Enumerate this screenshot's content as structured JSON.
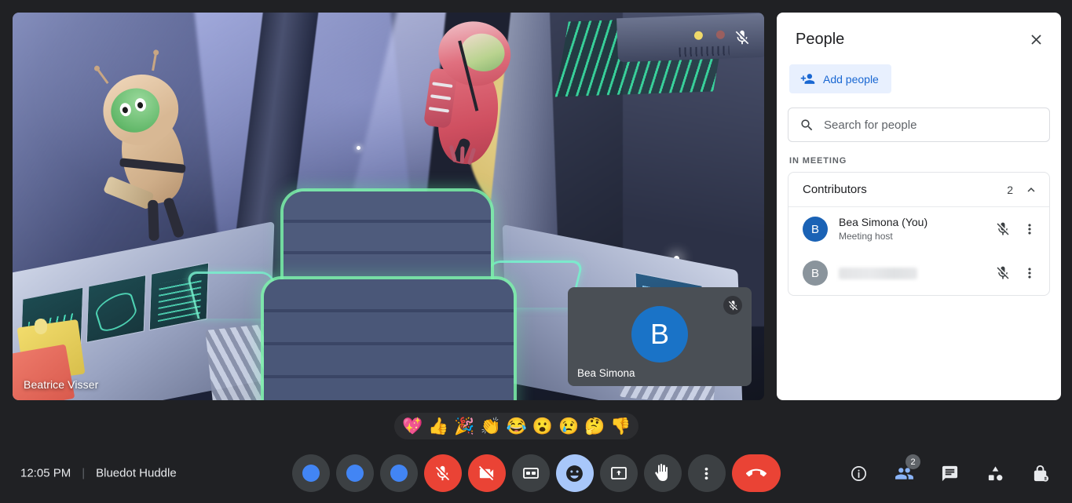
{
  "meeting": {
    "time": "12:05 PM",
    "separator": "|",
    "title": "Bluedot Huddle"
  },
  "main_video": {
    "participant_name": "Beatrice Visser",
    "mic_status_icon": "mic-off-icon",
    "muted": true
  },
  "self_view": {
    "name": "Bea Simona",
    "avatar_initial": "B",
    "avatar_color": "#1a73c7",
    "mic_status_icon": "mic-off-icon",
    "muted": true
  },
  "people_panel": {
    "title": "People",
    "close_icon": "close-icon",
    "add_people_label": "Add people",
    "add_people_icon": "person-add-icon",
    "add_people_bg": "#e8f0fe",
    "add_people_fg": "#1967d2",
    "search": {
      "icon": "search-icon",
      "placeholder": "Search for people",
      "value": ""
    },
    "section_label": "IN MEETING",
    "group": {
      "name": "Contributors",
      "count": "2",
      "expanded": true,
      "chevron_icon": "chevron-up-icon"
    },
    "participants": [
      {
        "name": "Bea Simona (You)",
        "subtitle": "Meeting host",
        "avatar_initial": "B",
        "avatar_color": "#1a62b5",
        "name_hidden": false,
        "mic_icon": "mic-off-icon",
        "more_icon": "more-vert-icon"
      },
      {
        "name": "",
        "subtitle": "",
        "avatar_initial": "B",
        "avatar_color": "#8a949c",
        "name_hidden": true,
        "mic_icon": "mic-off-icon",
        "more_icon": "more-vert-icon"
      }
    ]
  },
  "reactions": [
    {
      "name": "sparkling-heart-emoji",
      "glyph": "💖"
    },
    {
      "name": "thumbs-up-emoji",
      "glyph": "👍"
    },
    {
      "name": "party-popper-emoji",
      "glyph": "🎉"
    },
    {
      "name": "clapping-hands-emoji",
      "glyph": "👏"
    },
    {
      "name": "joy-emoji",
      "glyph": "😂"
    },
    {
      "name": "open-mouth-emoji",
      "glyph": "😮"
    },
    {
      "name": "crying-emoji",
      "glyph": "😢"
    },
    {
      "name": "thinking-emoji",
      "glyph": "🤔"
    },
    {
      "name": "thumbs-down-emoji",
      "glyph": "👎"
    }
  ],
  "center_controls": [
    {
      "name": "control-placeholder-1",
      "icon": "blue-dot-icon",
      "style": "dot",
      "label": ""
    },
    {
      "name": "control-placeholder-2",
      "icon": "blue-dot-icon",
      "style": "dot",
      "label": ""
    },
    {
      "name": "control-placeholder-3",
      "icon": "blue-dot-icon",
      "style": "dot",
      "label": ""
    },
    {
      "name": "microphone-toggle",
      "icon": "mic-off-icon",
      "style": "danger",
      "label": ""
    },
    {
      "name": "camera-toggle",
      "icon": "videocam-off-icon",
      "style": "danger",
      "label": ""
    },
    {
      "name": "captions-toggle",
      "icon": "closed-caption-icon",
      "style": "normal",
      "label": ""
    },
    {
      "name": "reactions-button",
      "icon": "emoji-face-icon",
      "style": "active",
      "label": ""
    },
    {
      "name": "present-screen-button",
      "icon": "present-to-all-icon",
      "style": "normal",
      "label": ""
    },
    {
      "name": "raise-hand-button",
      "icon": "raised-hand-icon",
      "style": "normal",
      "label": ""
    },
    {
      "name": "more-options-button",
      "icon": "more-vert-icon",
      "style": "normal",
      "label": ""
    },
    {
      "name": "leave-call-button",
      "icon": "call-end-icon",
      "style": "hangup",
      "label": ""
    }
  ],
  "right_controls": [
    {
      "name": "meeting-details-button",
      "icon": "info-icon",
      "badge": "",
      "active": false
    },
    {
      "name": "people-button",
      "icon": "people-icon",
      "badge": "2",
      "active": true
    },
    {
      "name": "chat-button",
      "icon": "chat-icon",
      "badge": "",
      "active": false
    },
    {
      "name": "activities-button",
      "icon": "activities-icon",
      "badge": "",
      "active": false
    },
    {
      "name": "host-controls-button",
      "icon": "lock-icon",
      "badge": "",
      "active": false
    }
  ],
  "colors": {
    "app_bg": "#202124",
    "accent_blue": "#4285f4",
    "danger_red": "#ea4335",
    "active_light_blue": "#a8c7fa",
    "panel_white": "#ffffff"
  }
}
